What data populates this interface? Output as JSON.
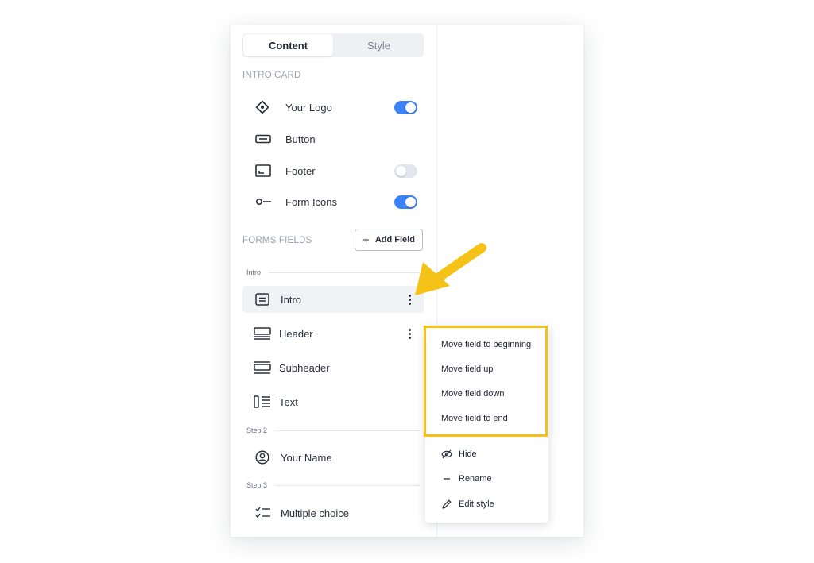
{
  "tabs": [
    {
      "label": "Content",
      "active": true
    },
    {
      "label": "Style",
      "active": false
    }
  ],
  "intro_card": {
    "title": "INTRO CARD",
    "items": [
      {
        "label": "Your Logo",
        "icon": "diamond-logo-icon",
        "toggle": "on"
      },
      {
        "label": "Button",
        "icon": "button-icon"
      },
      {
        "label": "Footer",
        "icon": "footer-icon",
        "toggle": "off"
      },
      {
        "label": "Form Icons",
        "icon": "form-icons-icon",
        "toggle": "on"
      }
    ]
  },
  "forms_fields": {
    "title": "FORMS FIELDS",
    "add_label": "Add Field",
    "groups": [
      {
        "label": "Intro",
        "fields": [
          {
            "label": "Intro",
            "icon": "intro-card-icon",
            "selected": true
          },
          {
            "label": "Header",
            "icon": "header-icon"
          },
          {
            "label": "Subheader",
            "icon": "subheader-icon"
          },
          {
            "label": "Text",
            "icon": "text-icon"
          }
        ]
      },
      {
        "label": "Step 2",
        "fields": [
          {
            "label": "Your Name",
            "icon": "user-circle-icon"
          }
        ]
      },
      {
        "label": "Step 3",
        "fields": [
          {
            "label": "Multiple choice",
            "icon": "checklist-icon"
          }
        ]
      }
    ]
  },
  "context_menu": {
    "items": [
      "Move field to beginning",
      "Move field up",
      "Move field down",
      "Move field to end"
    ],
    "actions": [
      {
        "label": "Hide",
        "icon": "eye-off-icon"
      },
      {
        "label": "Rename",
        "icon": "dash-icon"
      },
      {
        "label": "Edit style",
        "icon": "pencil-icon"
      }
    ]
  },
  "colors": {
    "accent": "#3b82f6",
    "highlight": "#f5c218",
    "arrow": "#f5c218"
  }
}
